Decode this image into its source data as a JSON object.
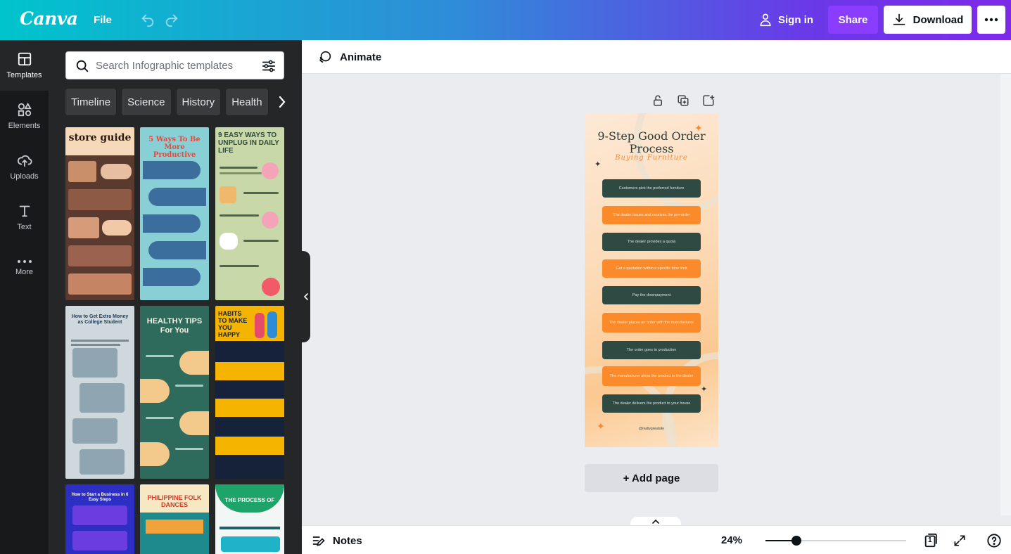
{
  "topbar": {
    "logo": "Canva",
    "file_label": "File",
    "signin_label": "Sign in",
    "share_label": "Share",
    "download_label": "Download"
  },
  "rail": {
    "items": [
      {
        "label": "Templates",
        "icon": "templates-icon"
      },
      {
        "label": "Elements",
        "icon": "elements-icon"
      },
      {
        "label": "Uploads",
        "icon": "uploads-icon"
      },
      {
        "label": "Text",
        "icon": "text-icon"
      },
      {
        "label": "More",
        "icon": "more-icon"
      }
    ]
  },
  "panel": {
    "search_placeholder": "Search Infographic templates",
    "chips": [
      "Timeline",
      "Science",
      "History",
      "Health"
    ],
    "templates": [
      {
        "title": "store guide",
        "bg": "#5a3a2e"
      },
      {
        "title": "5 Ways To Be More Productive",
        "bg": "#89cfd6"
      },
      {
        "title": "9 EASY WAYS TO UNPLUG IN DAILY LIFE",
        "bg": "#c8d8a8"
      },
      {
        "title": "How to Get Extra Money as College Student",
        "bg": "#cfd8dc"
      },
      {
        "title": "HEALTHY TIPS For You",
        "bg": "#2f6b5c"
      },
      {
        "title": "HABITS TO MAKE YOU HAPPY",
        "bg": "#f5b400"
      },
      {
        "title": "How to Start a Business in 6 Easy Steps",
        "bg": "#2d2fc4"
      },
      {
        "title": "PHILIPPINE FOLK DANCES",
        "bg": "#f7e8c4"
      },
      {
        "title": "THE PROCESS OF",
        "bg": "#f2f6f4"
      }
    ]
  },
  "editor": {
    "animate_label": "Animate",
    "add_page_label": "+ Add page",
    "notes_label": "Notes",
    "zoom": "24%",
    "zoom_fraction": 0.22,
    "page_count": "1"
  },
  "design": {
    "title": "9-Step Good Order Process",
    "subtitle": "Buying Furniture",
    "handle": "@reallygreatsite",
    "steps": [
      {
        "text": "Customers pick the preferred furniture",
        "style": "dark"
      },
      {
        "text": "The dealer issues and receives the pre-order",
        "style": "orange"
      },
      {
        "text": "The dealer provides a quota",
        "style": "dark"
      },
      {
        "text": "Get a quotation within a specific time limit",
        "style": "orange"
      },
      {
        "text": "Pay the downpayment",
        "style": "dark"
      },
      {
        "text": "The dealer places an order with the manufacturer",
        "style": "orange"
      },
      {
        "text": "The order goes to production",
        "style": "dark"
      },
      {
        "text": "The manufacturer ships the product to the dealer",
        "style": "orange"
      },
      {
        "text": "The dealer delivers the product to your house",
        "style": "dark"
      }
    ]
  }
}
